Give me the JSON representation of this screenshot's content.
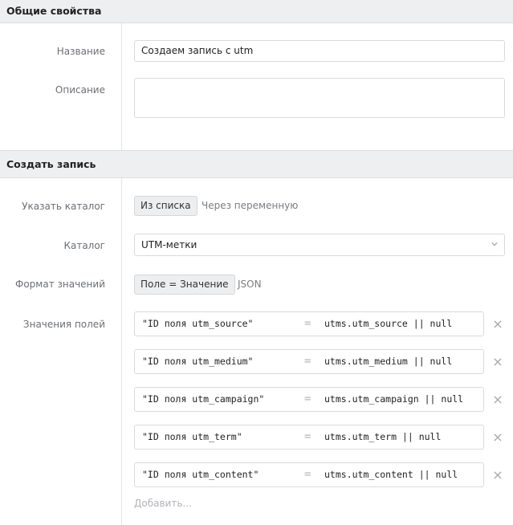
{
  "general": {
    "header": "Общие свойства",
    "name_label": "Название",
    "name_value": "Создаем запись с utm",
    "description_label": "Описание",
    "description_value": ""
  },
  "create": {
    "header": "Создать запись",
    "catalog_source_label": "Указать каталог",
    "catalog_source_options": [
      "Из списка",
      "Через переменную"
    ],
    "catalog_source_selected": "Из списка",
    "catalog_label": "Каталог",
    "catalog_value": "UTM-метки",
    "format_label": "Формат значений",
    "format_options": [
      "Поле = Значение",
      "JSON"
    ],
    "format_selected": "Поле = Значение",
    "fields_label": "Значения полей",
    "fields": [
      {
        "key": "\"ID поля utm_source\"",
        "eq": "=",
        "value": "utms.utm_source || null"
      },
      {
        "key": "\"ID поля utm_medium\"",
        "eq": "=",
        "value": "utms.utm_medium || null"
      },
      {
        "key": "\"ID поля utm_campaign\"",
        "eq": "=",
        "value": "utms.utm_campaign || null"
      },
      {
        "key": "\"ID поля utm_term\"",
        "eq": "=",
        "value": "utms.utm_term || null"
      },
      {
        "key": "\"ID поля utm_content\"",
        "eq": "=",
        "value": "utms.utm_content || null"
      }
    ],
    "add_label": "Добавить..."
  },
  "icons": {
    "remove": "close-icon",
    "dropdown": "chevron-down-icon"
  },
  "colors": {
    "header_bg": "#eeeff1",
    "label": "#6b6f75",
    "border": "#d9dadd"
  }
}
